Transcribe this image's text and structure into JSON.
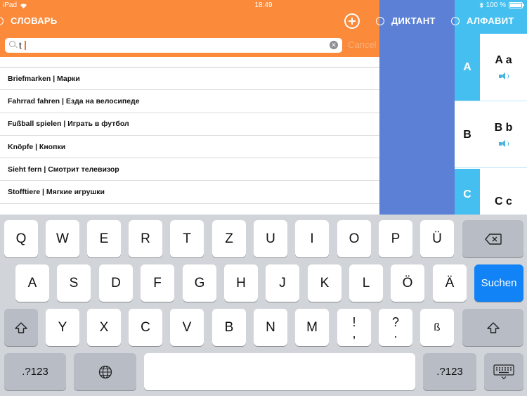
{
  "status_bar": {
    "device": "iPad",
    "time": "18:49",
    "battery": "100 %"
  },
  "tabs": {
    "dictionary": "СЛОВАРЬ",
    "dictation": "ДИКТАНТ",
    "alphabet": "АЛФАВИТ"
  },
  "search": {
    "value": "t",
    "cancel_label": "Cancel"
  },
  "words": [
    "Briefmarken | Марки",
    "Fahrrad fahren | Езда на велосипеде",
    "Fußball spielen | Играть в футбол",
    "Knöpfe | Кнопки",
    "Sieht fern | Смотрит телевизор",
    "Stofftiere | Мягкие игрушки"
  ],
  "alphabet": [
    {
      "capital": "A",
      "pair": "A a"
    },
    {
      "capital": "B",
      "pair": "B b"
    },
    {
      "capital": "C",
      "pair": "C c"
    }
  ],
  "colors": {
    "dictionary": "#fb8a3b",
    "dictation": "#5b80d6",
    "alphabet": "#44bff0",
    "keyboard_accent": "#1183f6"
  },
  "keyboard": {
    "row1": [
      "Q",
      "W",
      "E",
      "R",
      "T",
      "Z",
      "U",
      "I",
      "O",
      "P",
      "Ü"
    ],
    "row2": [
      "A",
      "S",
      "D",
      "F",
      "G",
      "H",
      "J",
      "K",
      "L",
      "Ö",
      "Ä"
    ],
    "row3": [
      "Y",
      "X",
      "C",
      "V",
      "B",
      "N",
      "M"
    ],
    "punct1": {
      "top": "!",
      "bottom": ","
    },
    "punct2": {
      "top": "?",
      "bottom": "."
    },
    "sharp_s": "ß",
    "search_label": "Suchen",
    "numbers_label": ".?123"
  }
}
